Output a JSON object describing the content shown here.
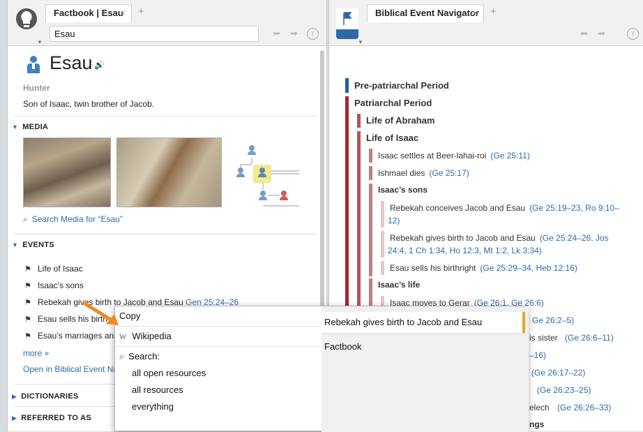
{
  "left_panel": {
    "tab_title": "Factbook | Esau",
    "tab_close": "×",
    "add_tab": "+",
    "search_value": "Esau",
    "entity": {
      "name": "Esau",
      "role": "Hunter",
      "description": "Son of Isaac, twin brother of Jacob."
    },
    "media": {
      "heading": "MEDIA",
      "search_link": "Search Media for “Esau”"
    },
    "events": {
      "heading": "EVENTS",
      "items": [
        {
          "label": "Life of Isaac",
          "ref": ""
        },
        {
          "label": "Isaac’s sons",
          "ref": ""
        },
        {
          "label": "Rebekah gives birth to Jacob and Esau",
          "ref": "Gen 25:24–26"
        },
        {
          "label": "Esau sells his birth",
          "ref": ""
        },
        {
          "label": "Esau’s marriages and",
          "ref": ""
        }
      ],
      "more": "more »",
      "open_link": "Open in Biblical Event Na"
    },
    "dictionaries": "DICTIONARIES",
    "referred_to_as": "REFERRED TO AS"
  },
  "right_panel": {
    "tab_title": "Biblical Event Navigator",
    "tab_close": "×",
    "add_tab": "+",
    "timeline": [
      {
        "label": "Pre-patriarchal Period",
        "ref": "",
        "level": 0,
        "bold": true
      },
      {
        "label": "Patriarchal Period",
        "ref": "",
        "level": 0,
        "bold": true
      },
      {
        "label": "Life of Abraham",
        "ref": "",
        "level": 1,
        "bold": true
      },
      {
        "label": "Life of Isaac",
        "ref": "",
        "level": 1,
        "bold": true
      },
      {
        "label": "Isaac settles at Beer-lahai-roi",
        "ref": "(Ge 25:11)",
        "level": 2,
        "bold": false
      },
      {
        "label": "Ishmael dies",
        "ref": "(Ge 25:17)",
        "level": 2,
        "bold": false
      },
      {
        "label": "Isaac’s sons",
        "ref": "",
        "level": 2,
        "bold": true
      },
      {
        "label": "Rebekah conceives Jacob and Esau",
        "ref": "(Ge 25:19–23, Ro 9:10–",
        "ref2": "12)",
        "level": 3,
        "bold": false
      },
      {
        "label": "Rebekah gives birth to Jacob and Esau",
        "ref": "(Ge 25:24–26, Jos",
        "ref2": "24:4, 1 Ch 1:34, Ho 12:3, Mt 1:2, Lk 3:34)",
        "level": 3,
        "bold": false
      },
      {
        "label": "Esau sells his birthright",
        "ref": "(Ge 25:29–34, Heb 12:16)",
        "level": 3,
        "bold": false
      },
      {
        "label": "Isaac’s life",
        "ref": "",
        "level": 2,
        "bold": true
      },
      {
        "label": "Isaac moves to Gerar",
        "ref": "(Ge 26:1, Ge 26:6)",
        "level": 3,
        "bold": false
      }
    ],
    "partial_refs": [
      "Ge 26:2–5)",
      "is sister",
      "(Ge 26:6–11)",
      "–16)",
      "(Ge 26:17–22)",
      "(Ge 26:23–25)",
      "elech",
      "(Ge 26:26–33)",
      "ngs"
    ]
  },
  "context_menu": {
    "copy": "Copy",
    "wikipedia": "Wikipedia",
    "search_label": "Search:",
    "search_options": [
      "all open resources",
      "all resources",
      "everything"
    ],
    "selected_text": "Rebekah gives birth to Jacob and Esau",
    "factbook": "Factbook"
  },
  "colors": {
    "accent": "#2f6aa8",
    "timeline_dark": "#9e2a2b",
    "timeline_mid": "#c27f80",
    "timeline_light": "#e6c6c6",
    "selection": "#f0a030"
  }
}
